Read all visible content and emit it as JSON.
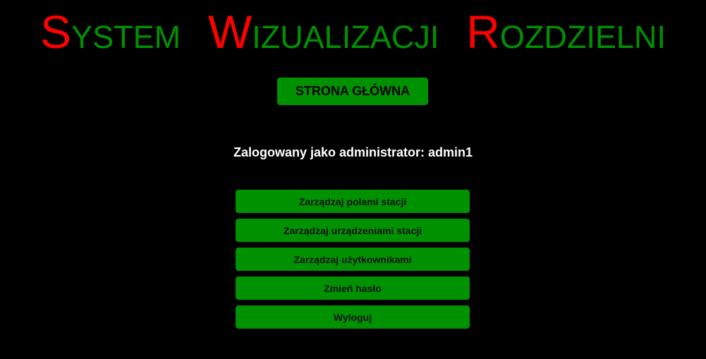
{
  "header": {
    "title_words": [
      {
        "initial": "S",
        "rest": "YSTEM"
      },
      {
        "initial": "W",
        "rest": "IZUALIZACJI"
      },
      {
        "initial": "R",
        "rest": "OZDZIELNI"
      }
    ],
    "home_button_label": "STRONA GŁÓWNA"
  },
  "status": {
    "logged_in_text": "Zalogowany jako administrator: admin1"
  },
  "menu": {
    "items": [
      {
        "label": "Zarządzaj polami stacji"
      },
      {
        "label": "Zarządzaj urządzeniami stacji"
      },
      {
        "label": "Zarządzaj użytkownikami"
      },
      {
        "label": "Zmień hasło"
      },
      {
        "label": "Wyloguj"
      }
    ]
  },
  "colors": {
    "background": "#000000",
    "accent_green": "#009100",
    "initial_red": "#ff0000",
    "text_white": "#ffffff"
  }
}
